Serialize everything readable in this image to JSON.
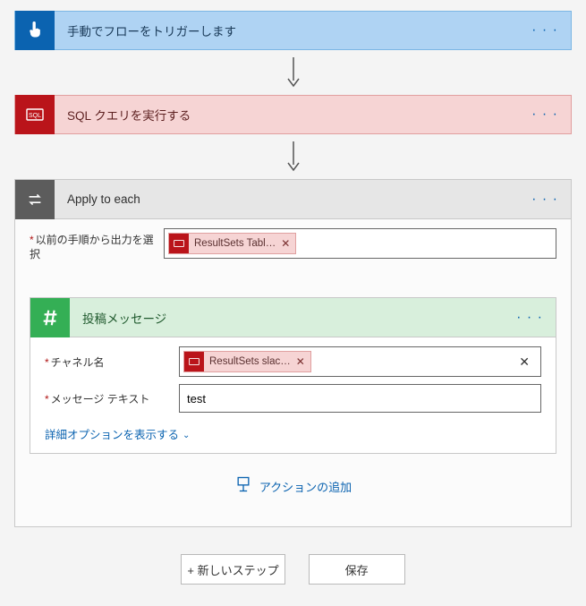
{
  "trigger": {
    "title": "手動でフローをトリガーします"
  },
  "sql": {
    "title": "SQL クエリを実行する"
  },
  "each": {
    "title": "Apply to each",
    "inputs": {
      "from_label": "以前の手順から出力を選択",
      "token_label": "ResultSets Tabl…"
    }
  },
  "slack": {
    "title": "投稿メッセージ",
    "channel_label": "チャネル名",
    "channel_token": "ResultSets slac…",
    "message_label": "メッセージ テキスト",
    "message_value": "test",
    "advanced": "詳細オプションを表示する"
  },
  "add_action": "アクションの追加",
  "buttons": {
    "new_step": "+ 新しいステップ",
    "save": "保存"
  }
}
